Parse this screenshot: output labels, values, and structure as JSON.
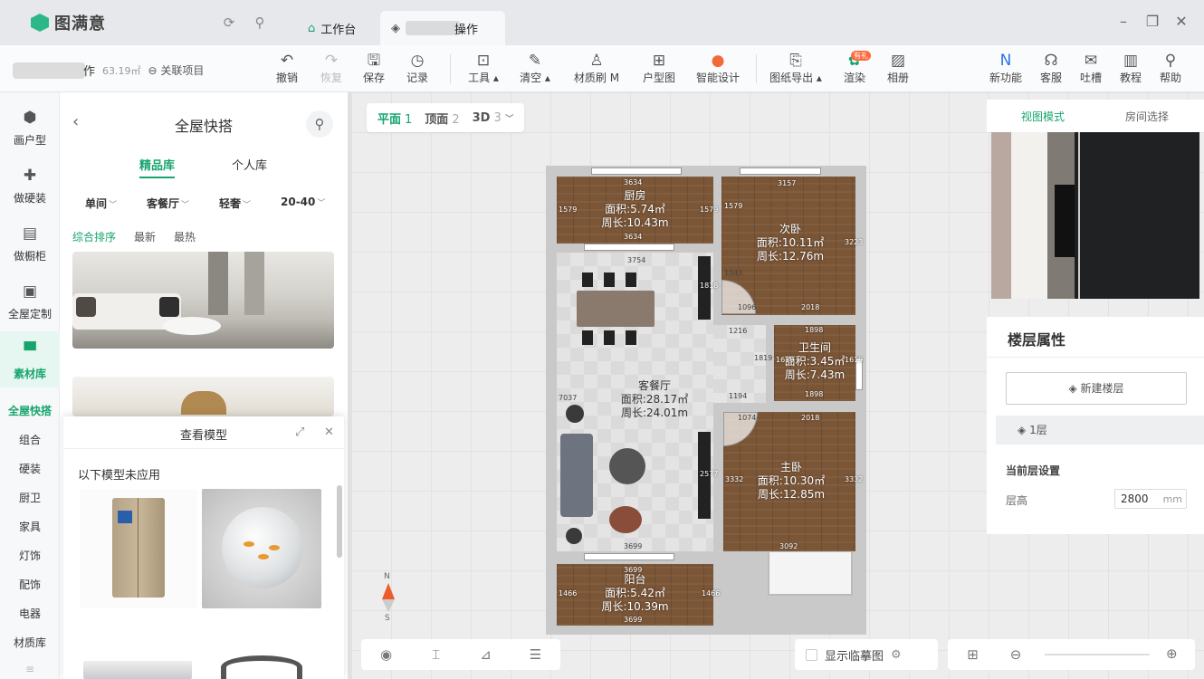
{
  "app": {
    "name": "图满意"
  },
  "titlebar": {
    "tabs": [
      {
        "label": "工作台"
      },
      {
        "label": "操作"
      }
    ],
    "window": {
      "minimize": "–",
      "restore": "❐",
      "close": "✕"
    }
  },
  "project": {
    "name": "作",
    "area": "63.19㎡",
    "link_label": "关联项目"
  },
  "toolbar": {
    "undo": "撤销",
    "redo": "恢复",
    "save": "保存",
    "history": "记录",
    "tools": "工具",
    "clear": "清空",
    "material_brush": "材质刷 M",
    "floorplan": "户型图",
    "smart_design": "智能设计",
    "drawing_export": "图纸导出",
    "render": "渲染",
    "render_badge": "有礼",
    "album": "相册",
    "new_features": "新功能",
    "service": "客服",
    "feedback": "吐槽",
    "tutorial": "教程",
    "help": "帮助"
  },
  "nav": {
    "items": [
      {
        "label": "画户型"
      },
      {
        "label": "做硬装"
      },
      {
        "label": "做橱柜"
      },
      {
        "label": "全屋定制"
      },
      {
        "label": "素材库"
      }
    ],
    "sub_items": [
      {
        "label": "全屋快搭"
      },
      {
        "label": "组合"
      },
      {
        "label": "硬装"
      },
      {
        "label": "厨卫"
      },
      {
        "label": "家具"
      },
      {
        "label": "灯饰"
      },
      {
        "label": "配饰"
      },
      {
        "label": "电器"
      },
      {
        "label": "材质库"
      }
    ]
  },
  "panel": {
    "title": "全屋快搭",
    "tabs": [
      {
        "label": "精品库"
      },
      {
        "label": "个人库"
      }
    ],
    "filters": [
      {
        "label": "单间"
      },
      {
        "label": "客餐厅"
      },
      {
        "label": "轻奢"
      },
      {
        "label": "20-40"
      }
    ],
    "sorts": [
      {
        "label": "综合排序"
      },
      {
        "label": "最新"
      },
      {
        "label": "最热"
      }
    ]
  },
  "view_model": {
    "title": "查看模型",
    "subtitle": "以下模型未应用"
  },
  "view_switch": {
    "plan": "平面",
    "plan_num": "1",
    "ceiling": "顶面",
    "ceiling_num": "2",
    "three_d": "3D",
    "three_d_num": "3"
  },
  "floorplan": {
    "rooms": {
      "kitchen": {
        "name": "厨房",
        "area": "面积:5.74㎡",
        "perimeter": "周长:10.43m"
      },
      "second_bedroom": {
        "name": "次卧",
        "area": "面积:10.11㎡",
        "perimeter": "周长:12.76m"
      },
      "bathroom": {
        "name": "卫生间",
        "area": "面积:3.45㎡",
        "perimeter": "周长:7.43m"
      },
      "living_dining": {
        "name": "客餐厅",
        "area": "面积:28.17㎡",
        "perimeter": "周长:24.01m"
      },
      "master_bedroom": {
        "name": "主卧",
        "area": "面积:10.30㎡",
        "perimeter": "周长:12.85m"
      },
      "balcony": {
        "name": "阳台",
        "area": "面积:5.42㎡",
        "perimeter": "周长:10.39m"
      }
    },
    "dims": {
      "k_top": "3634",
      "k_bottom": "3634",
      "k_left": "1579",
      "k_right": "1579",
      "sb_top": "3157",
      "sb_bottom": "2018",
      "sb_right": "3223",
      "sb_left": "1579",
      "sb_door": "1096",
      "sb_left2": "1043",
      "b_top": "1898",
      "b_bottom": "1898",
      "b_left": "1619",
      "b_right": "1619",
      "l_top": "3754",
      "l_left": "7037",
      "l_bottom": "3699",
      "l_mid": "1216",
      "l_mid2": "1194",
      "l_mid3": "1819",
      "l_tv": "1818",
      "l_tv2": "2577",
      "m_top": "2018",
      "m_door": "1074",
      "m_left": "3332",
      "m_right": "3332",
      "m_bottom": "3092",
      "bal_top": "3699",
      "bal_bottom": "3699",
      "bal_left": "1466",
      "bal_right": "1466"
    },
    "compass_n": "N",
    "compass_s": "S"
  },
  "right_panel": {
    "tabs": [
      {
        "label": "视图模式"
      },
      {
        "label": "房间选择"
      }
    ],
    "floor_props_title": "楼层属性",
    "new_floor": "新建楼层",
    "floor_item": "1层",
    "current_setting": "当前层设置",
    "height_label": "层高",
    "height_value": "2800",
    "height_unit": "mm"
  },
  "bottom": {
    "show_trace": "显示临摹图"
  }
}
